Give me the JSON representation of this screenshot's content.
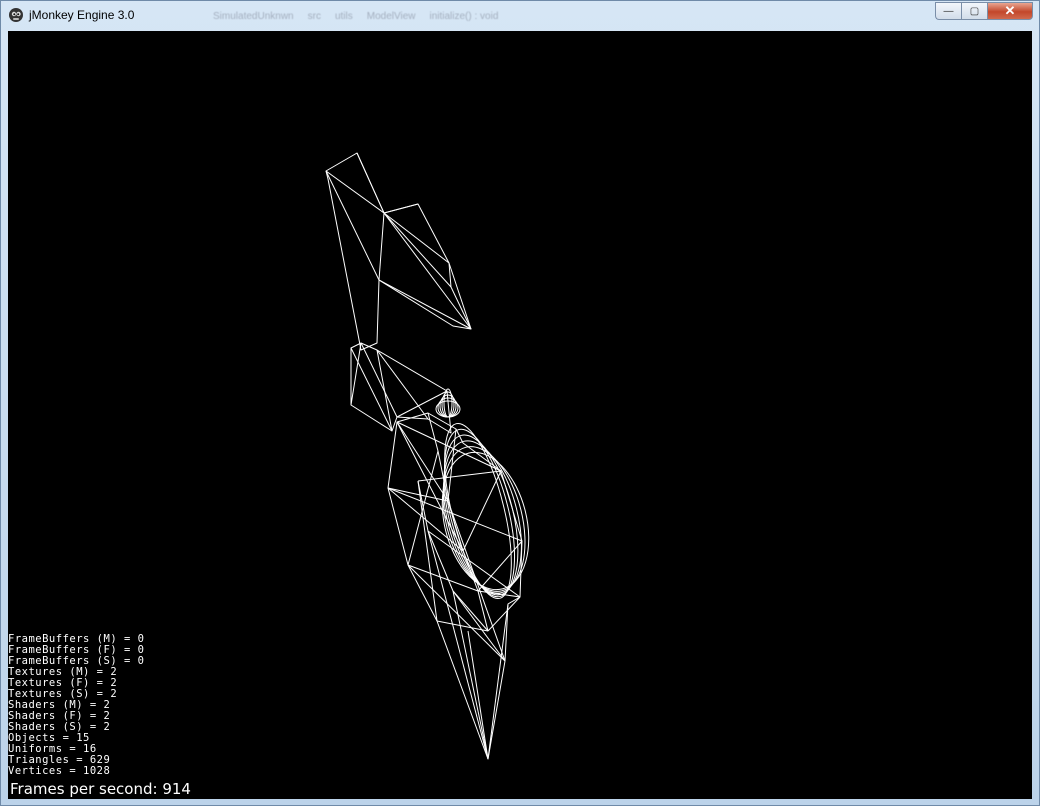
{
  "window": {
    "title": "jMonkey Engine 3.0",
    "minimize_glyph": "—",
    "maximize_glyph": "▢",
    "close_glyph": "✕"
  },
  "background_toolbar": {
    "items": [
      "SimulatedUnknwn",
      "src",
      "utils",
      "ModelView",
      "initialize() : void"
    ]
  },
  "scene": {
    "render_mode": "wireframe",
    "wire_color": "#ffffff",
    "background_color": "#000000"
  },
  "stats": [
    "FrameBuffers (M) = 0",
    "FrameBuffers (F) = 0",
    "FrameBuffers (S) = 0",
    "Textures (M) = 2",
    "Textures (F) = 2",
    "Textures (S) = 2",
    "Shaders (M) = 2",
    "Shaders (F) = 2",
    "Shaders (S) = 2",
    "Objects = 15",
    "Uniforms = 16",
    "Triangles = 629",
    "Vertices = 1028"
  ],
  "fps_text": "Frames per second: 914"
}
